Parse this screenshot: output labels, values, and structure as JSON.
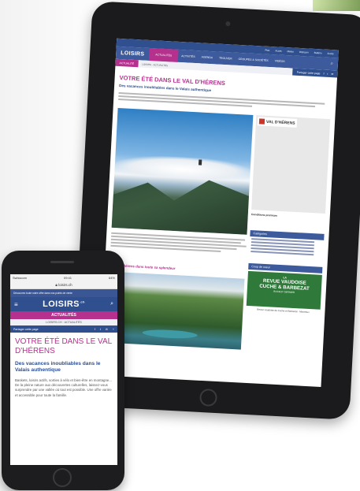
{
  "tablet": {
    "topbar": [
      "Plan",
      "Accès",
      "Meteo",
      "Webcam",
      "Bulletin",
      "Accès"
    ],
    "logo": "LOISIRS",
    "nav": [
      "ACTUALITÉS",
      "ACTIVITÉS",
      "AGENDA",
      "TROUVER",
      "GROUPES & SOCIÉTÉS",
      "VIDÉOS"
    ],
    "sub_tag": "ACTUALITÉ",
    "crumb": "LOISIRS · ACTUALITÉS",
    "share": "Partager cette page",
    "title": "VOTRE ÉTÉ DANS LE VAL D'HÉRENS",
    "subtitle": "Des vacances inoubliables dans le Valais authentique",
    "side_logo": "VAL D'HÉRENS",
    "side_caption": "Conditions premium",
    "categories": "Catégories",
    "coup": "Coup de coeur",
    "ad_line1": "LA",
    "ad_line2": "REVUE VAUDOISE",
    "ad_line3": "CUCHE & BARBEZAT",
    "ad_line4": "BUGEUT DERNIER",
    "ad_caption": "Revue vaudoise de Cuche et Barbezat · Montreux",
    "section2": "Le val d'hérens dans toute sa splendeur"
  },
  "phone": {
    "status_left": "Swisscom",
    "status_time": "09:41",
    "status_right": "64%",
    "url": "loisirs.ch",
    "notice": "Découvrez toute notre offre dans nos points de vente",
    "logo": "LOISIRS",
    "logo_sup": ".ch",
    "section": "ACTUALITÉS",
    "crumb": "LOISIRS.CH · ACTUALITÉS",
    "share": "Partager cette page",
    "title": "VOTRE ÉTÉ DANS LE VAL D'HÉRENS",
    "subtitle": "Des vacances inoubliables dans le Valais authentique",
    "body": "Baskets, loisirs actifs, sorties à vélo et bien-être en montagne... De la pleine nature aux découvertes culturelles, laissez-vous surprendre par une vallée où tout est possible. Une offre variée et accessible pour toute la famille."
  },
  "colors": {
    "brand_blue": "#2f4f8f",
    "accent_magenta": "#b6308e"
  }
}
